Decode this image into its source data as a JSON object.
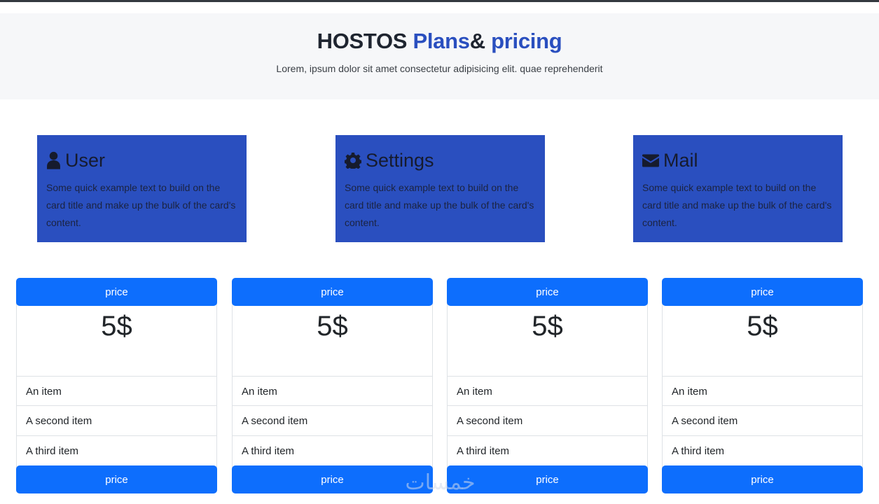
{
  "header": {
    "brand": "HOSTOS",
    "plans": "Plans",
    "amp": "&",
    "pricing": "pricing",
    "subtitle": "Lorem, ipsum dolor sit amet consectetur adipisicing elit. quae reprehenderit"
  },
  "features": [
    {
      "icon": "user-icon",
      "title": "User",
      "text": "Some quick example text to build on the card title and make up the bulk of the card's content."
    },
    {
      "icon": "gear-icon",
      "title": "Settings",
      "text": "Some quick example text to build on the card title and make up the bulk of the card's content."
    },
    {
      "icon": "envelope-icon",
      "title": "Mail",
      "text": "Some quick example text to build on the card title and make up the bulk of the card's content."
    }
  ],
  "plans": [
    {
      "header_label": "price",
      "price": "5$",
      "items": [
        "An item",
        "A second item",
        "A third item"
      ],
      "footer_label": "price"
    },
    {
      "header_label": "price",
      "price": "5$",
      "items": [
        "An item",
        "A second item",
        "A third item"
      ],
      "footer_label": "price"
    },
    {
      "header_label": "price",
      "price": "5$",
      "items": [
        "An item",
        "A second item",
        "A third item"
      ],
      "footer_label": "price"
    },
    {
      "header_label": "price",
      "price": "5$",
      "items": [
        "An item",
        "A second item",
        "A third item"
      ],
      "footer_label": "price"
    }
  ],
  "watermark": "خمسات",
  "colors": {
    "accent": "#2a4fbf",
    "button": "#0d6efd",
    "hero_background": "#f6f7f9"
  }
}
